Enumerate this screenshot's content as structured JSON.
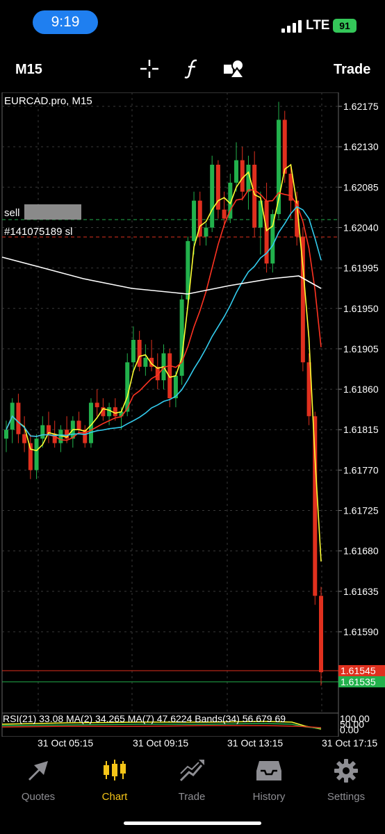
{
  "status": {
    "time": "9:19",
    "network": "LTE",
    "battery": "91"
  },
  "toolbar": {
    "timeframe": "M15",
    "trade_label": "Trade",
    "icons": [
      "crosshair-icon",
      "function-icon",
      "objects-icon"
    ]
  },
  "chart": {
    "symbol_label": "EURCAD.pro, M15",
    "order_sell_label": "sell",
    "order_ticket": "#141075189 sl",
    "price_ticks": [
      "1.62175",
      "1.62130",
      "1.62085",
      "1.62040",
      "1.61995",
      "1.61950",
      "1.61905",
      "1.61860",
      "1.61815",
      "1.61770",
      "1.61725",
      "1.61680",
      "1.61635",
      "1.61590"
    ],
    "bid_label": "1.61545",
    "ask_label": "1.61535",
    "indicator_label": "RSI(21) 33.08 MA(2) 34.265 MA(7) 47.6224 Bands(34) 56.679 69",
    "rsi_ticks": [
      "100.00",
      "50.00",
      "0.00"
    ],
    "time_labels": [
      "31 Oct 05:15",
      "31 Oct 09:15",
      "31 Oct 13:15",
      "31 Oct 17:15"
    ],
    "colors": {
      "bull": "#22b14c",
      "bear": "#e0301e",
      "ma_fast": "#ffff33",
      "ma_mid": "#ff3322",
      "ma_slow": "#33ccee",
      "ma_long": "#ffffff"
    }
  },
  "tabs": [
    {
      "label": "Quotes",
      "icon": "quotes-icon",
      "active": false
    },
    {
      "label": "Chart",
      "icon": "chart-icon",
      "active": true
    },
    {
      "label": "Trade",
      "icon": "trade-icon",
      "active": false
    },
    {
      "label": "History",
      "icon": "history-icon",
      "active": false
    },
    {
      "label": "Settings",
      "icon": "settings-icon",
      "active": false
    }
  ]
}
